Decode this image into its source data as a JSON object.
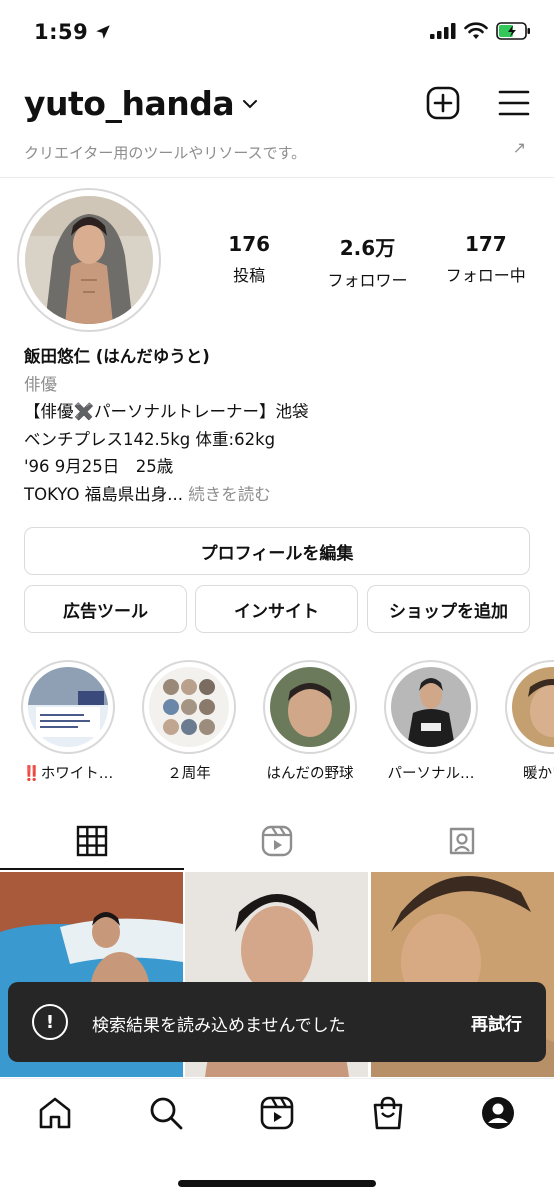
{
  "status_bar": {
    "time": "1:59"
  },
  "header": {
    "username": "yuto_handa",
    "creator_hint": "クリエイター用のツールやリソースです。"
  },
  "stats": [
    {
      "value": "176",
      "label": "投稿"
    },
    {
      "value": "2.6万",
      "label": "フォロワー"
    },
    {
      "value": "177",
      "label": "フォロー中"
    }
  ],
  "bio": {
    "name": "飯田悠仁 (はんだゆうと)",
    "category": "俳優",
    "lines": [
      "【俳優✖️パーソナルトレーナー】池袋",
      "ベンチプレス142.5kg 体重:62kg",
      "'96 9月25日　25歳"
    ],
    "last_line": "TOKYO 福島県出身...",
    "more_label": "続きを読む"
  },
  "buttons": {
    "edit_profile": "プロフィールを編集",
    "ad_tools": "広告ツール",
    "insights": "インサイト",
    "add_shop": "ショップを追加"
  },
  "highlights": [
    {
      "label": "‼️ホワイト…"
    },
    {
      "label": "２周年"
    },
    {
      "label": "はんだの野球"
    },
    {
      "label": "パーソナル…"
    },
    {
      "label": "暖かい気"
    }
  ],
  "toast": {
    "message": "検索結果を読み込めませんでした",
    "action": "再試行"
  },
  "colors": {
    "text": "#111111",
    "muted": "#8e8e8e",
    "border": "#dbdbdb",
    "toast_bg": "#262626",
    "battery_green": "#34c759"
  },
  "icons": {
    "status": [
      "location-arrow-icon",
      "signal-icon",
      "wifi-icon",
      "battery-icon"
    ],
    "header": [
      "chevron-down-icon",
      "new-post-icon",
      "menu-icon"
    ],
    "tabs": [
      "grid-icon",
      "reels-icon",
      "tagged-icon"
    ],
    "tabbar": [
      "home-icon",
      "search-icon",
      "reels-icon",
      "shop-icon",
      "profile-icon"
    ]
  }
}
